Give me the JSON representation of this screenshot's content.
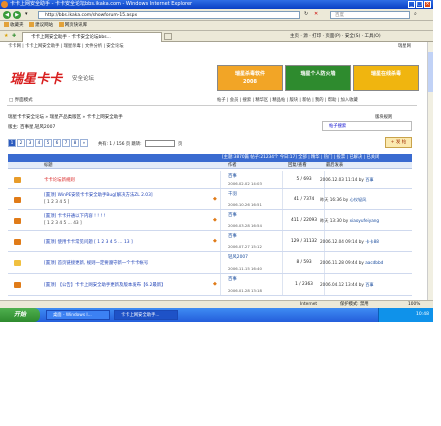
{
  "window": {
    "title": "卡卡上网安全助手 - 卡卡安全论坛bbs.ikaka.com - Windows Internet Explorer"
  },
  "addressbar": {
    "url": "http://bbs.ikaka.com/showforum-15.aspx",
    "search_placeholder": "百度"
  },
  "favorites": {
    "items": [
      "收藏夹",
      "建议网站",
      "网页快讯库"
    ]
  },
  "tabs": {
    "active_tab": "卡卡上网安全助手 - 卡卡安全论坛bbs...",
    "tools": "主页 · 源 · 打印 · 页面(P) · 安全(S) · 工具(O)"
  },
  "page": {
    "toplinks": "卡卡网 | 卡卡上网安全助手 | 瑞星杀毒 | 文件分析 | 安全论坛",
    "toplinks_right": "瑞星网",
    "logo": "瑞星卡卡",
    "logo_sub": "安全论坛",
    "banners": [
      {
        "label": "瑞星杀毒软件",
        "sub": "2008",
        "bg": "#f2a526",
        "fg": "#ffffff"
      },
      {
        "label": "瑞星个人防火墙",
        "sub": "",
        "bg": "#2e8b2e",
        "fg": "#ffffff"
      },
      {
        "label": "瑞星在线杀毒",
        "sub": "",
        "bg": "#f0b50f",
        "fg": "#ffffff"
      }
    ],
    "menu_left": "□ 界面模式",
    "menu_right": "帖子 | 会员 | 搜索 | 精华区 | 精品帖 | 版块 | 新帖 | 我的 | 帮助 | 加入收藏",
    "breadcrumb": "瑞星卡卡安全论坛 » 瑞星产品类版区 » 卡卡上网安全助手",
    "moderators": "版主: 百事星,轻风2007",
    "breadcrumb_right": "版块规则",
    "forum_search": "帖子搜索",
    "pager": [
      "1",
      "2",
      "3",
      "4",
      "5",
      "6",
      "7",
      "8",
      "»"
    ],
    "pager_text": "共有: 1 / 156 页   跳转:",
    "page_unit": "页",
    "post_button": "+ 发 帖",
    "table_header": "[主题:3870篇 帖子:21234个 今日:17] 全部 | 精华 | 热门 | 投票 | 已解决 | 已关闭",
    "columns": {
      "title": "标题",
      "author": "作者",
      "rv": "回复/查看",
      "last": "最后发表"
    },
    "rows": [
      {
        "icon": "announce",
        "title": "卡卡论坛新规则",
        "title_color": "#d81d1d",
        "title2": "",
        "clip": "",
        "author": "百事",
        "date": "2006.02.02 14:03",
        "rv": "5 / 693",
        "last_date": "2006.12.03 11:14",
        "last_by": "by",
        "last_user": "百事"
      },
      {
        "icon": "pin",
        "title": "[置顶] WinPE安装卡卡安全助手Bug[解决方法ZL 2.03]",
        "title_color": "#1c3fb5",
        "title2": "[ 1 2 3 4 5 ]",
        "clip": "◆",
        "author": "千羽",
        "date": "2006.10.26 16:51",
        "rv": "41 / 7374",
        "last_date": "昨天 16:36",
        "last_by": "by",
        "last_user": "心仪轻风"
      },
      {
        "icon": "pin",
        "title": "[置顶] 卡卡开通以下内容 ! ! ! !",
        "title_color": "#1c3fb5",
        "title2": "[ 1 2 3 4 5 … 43 ]",
        "clip": "◆",
        "author": "百事",
        "date": "2006.03.28 16:54",
        "rv": "411 / 22093",
        "last_date": "昨天 13:30",
        "last_by": "by",
        "last_user": "xiaoyufeiyang"
      },
      {
        "icon": "pin",
        "title": "[置顶] 使用卡卡常见问题   [ 1 2 3 4 5 … 13 ]",
        "title_color": "#1c3fb5",
        "title2": "",
        "clip": "◆",
        "author": "百事",
        "date": "2006.07.27 15:12",
        "rv": "129 / 31132",
        "last_date": "2006.12.04 09:14",
        "last_by": "by",
        "last_user": "卡卡88"
      },
      {
        "icon": "hot",
        "title": "[置顶] 首页链接更新, 规则一定要遵守新一个卡卡帐号",
        "title_color": "#1c3fb5",
        "title2": "",
        "clip": "",
        "author": "轻风2007",
        "date": "2006.11.15 16:40",
        "rv": "8 / 593",
        "last_date": "2006.11.28 09:44",
        "last_by": "by",
        "last_user": "aacdbbd"
      },
      {
        "icon": "pin",
        "title": "[置顶] 【公告】卡卡上网安全助手更新及版本发布【6.2最新】",
        "title_color": "#1c3fb5",
        "title2": "",
        "clip": "◆",
        "author": "百事",
        "date": "2006.01.28 13:18",
        "rv": "1 / 2363",
        "last_date": "2006.04.12 13:44",
        "last_by": "by",
        "last_user": "百事"
      }
    ]
  },
  "statusbar": {
    "left": "",
    "zone": "Internet",
    "protected": "保护模式: 禁用",
    "zoom": "100%"
  },
  "taskbar": {
    "start": "开始",
    "tasks": [
      "桌面 - Windows I...",
      "卡卡上网安全助手..."
    ],
    "clock": "10:48"
  },
  "colors": {
    "title_blue": "#0a3fc4",
    "accent_red": "#d81d1d",
    "table_blue": "#3a6bd0"
  }
}
